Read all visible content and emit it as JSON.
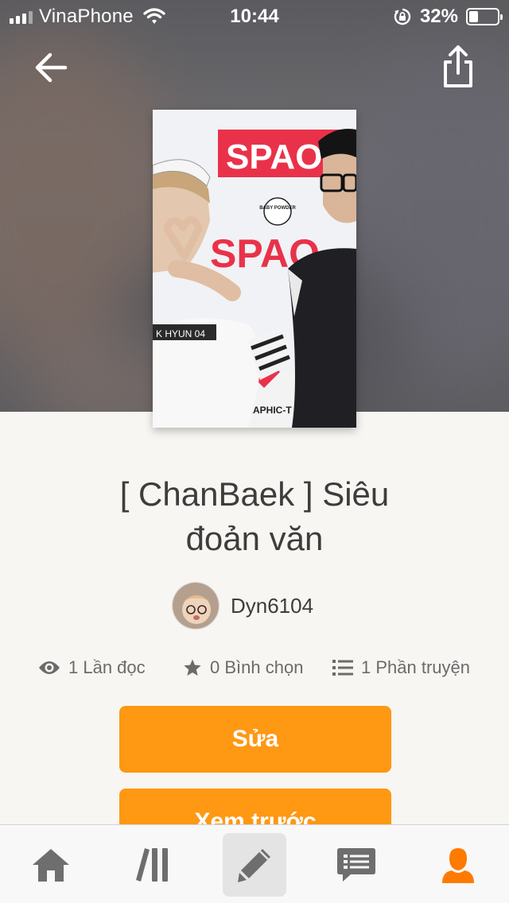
{
  "status_bar": {
    "carrier": "VinaPhone",
    "time": "10:44",
    "battery_percent": "32%",
    "battery_level": 0.32
  },
  "header": {
    "back_icon": "arrow-left-icon",
    "share_icon": "share-icon"
  },
  "story": {
    "title": "[ ChanBaek ] Siêu\nđoản văn",
    "author": "Dyn6104"
  },
  "stats": {
    "reads": "1 Lần đọc",
    "votes": "0 Bình chọn",
    "parts": "1 Phần truyện"
  },
  "actions": {
    "edit_label": "Sửa",
    "preview_label": "Xem trước"
  },
  "cover_text": {
    "sign_top": "SPAO",
    "sign_mid": "SPAO",
    "sticker": "BABY POWDER",
    "shirt": "K HYUN 04",
    "banner": "GRAPHIC-T • SP"
  },
  "tabbar": {
    "items": [
      "home-icon",
      "library-icon",
      "write-icon",
      "messages-icon",
      "profile-icon"
    ],
    "active": "profile-icon",
    "active_color": "#ff7a00",
    "icon_color": "#6e6e6e"
  },
  "colors": {
    "accent": "#ff9812",
    "background": "#f7f6f2"
  }
}
